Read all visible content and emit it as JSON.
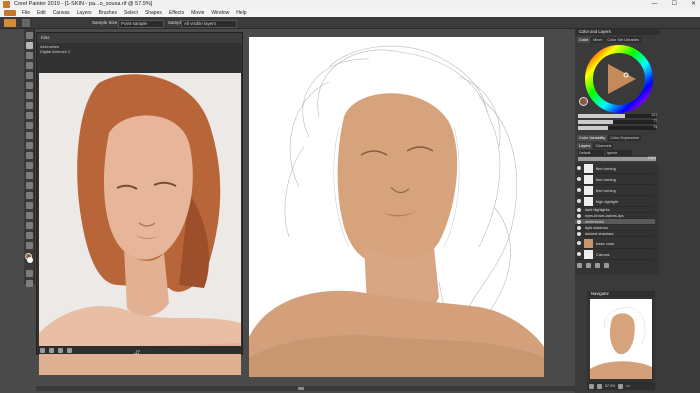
{
  "window": {
    "title": "Corel Painter 2019 - [1-SKIN - pa...o_sousa.rif @ 57.9%]",
    "controls": [
      "—",
      "☐",
      "✕"
    ]
  },
  "menu": [
    "File",
    "Edit",
    "Canvas",
    "Layers",
    "Brushes",
    "Select",
    "Shapes",
    "Effects",
    "Movie",
    "Window",
    "Help"
  ],
  "property_bar": {
    "sample_size_label": "Sample Size",
    "sample_size_value": "Point sample",
    "sample_label": "Sample",
    "sample_value": "All visible layers"
  },
  "reference_panel": {
    "tab": "Kiss",
    "brush_category": "Airbrushes",
    "brush_variant": "Digital Airbrush 2",
    "footer_more": "•••"
  },
  "color_panel": {
    "title": "Color and Layers",
    "tabs": [
      "Color",
      "Mixer",
      "Color Set Libraries"
    ],
    "values": [
      "127",
      "77",
      "73"
    ],
    "hue_ring": [
      "#ff0000",
      "#ffff00",
      "#00ff00",
      "#00ffff",
      "#0000ff",
      "#ff00ff"
    ],
    "main_color": "#8b5a3c",
    "secondary_color": "#ffffff"
  },
  "variability_panel": {
    "tabs": [
      "Color Variability",
      "Color Expression"
    ]
  },
  "layers_panel": {
    "tabs": [
      "Layers",
      "Channels"
    ],
    "composite_method": "Default",
    "composite_depth": "Ignore",
    "opacity": "100%",
    "rows": [
      {
        "name": "fine turning",
        "kind": "layer"
      },
      {
        "name": "fine turning",
        "kind": "layer"
      },
      {
        "name": "fine turning",
        "kind": "layer"
      },
      {
        "name": "high lighlight",
        "kind": "layer"
      },
      {
        "name": "dark highlights",
        "kind": "group"
      },
      {
        "name": "eyes-brows-lashes-lips",
        "kind": "group"
      },
      {
        "name": "undertones",
        "kind": "group",
        "selected": true
      },
      {
        "name": "light shadows",
        "kind": "group"
      },
      {
        "name": "darkest shadows",
        "kind": "group"
      },
      {
        "name": "base color",
        "kind": "layer"
      },
      {
        "name": "Canvas",
        "kind": "canvas"
      }
    ]
  },
  "navigator": {
    "title": "Navigator",
    "zoom": "57.9%",
    "more": "•••"
  },
  "canvas": {
    "more": "•••"
  }
}
